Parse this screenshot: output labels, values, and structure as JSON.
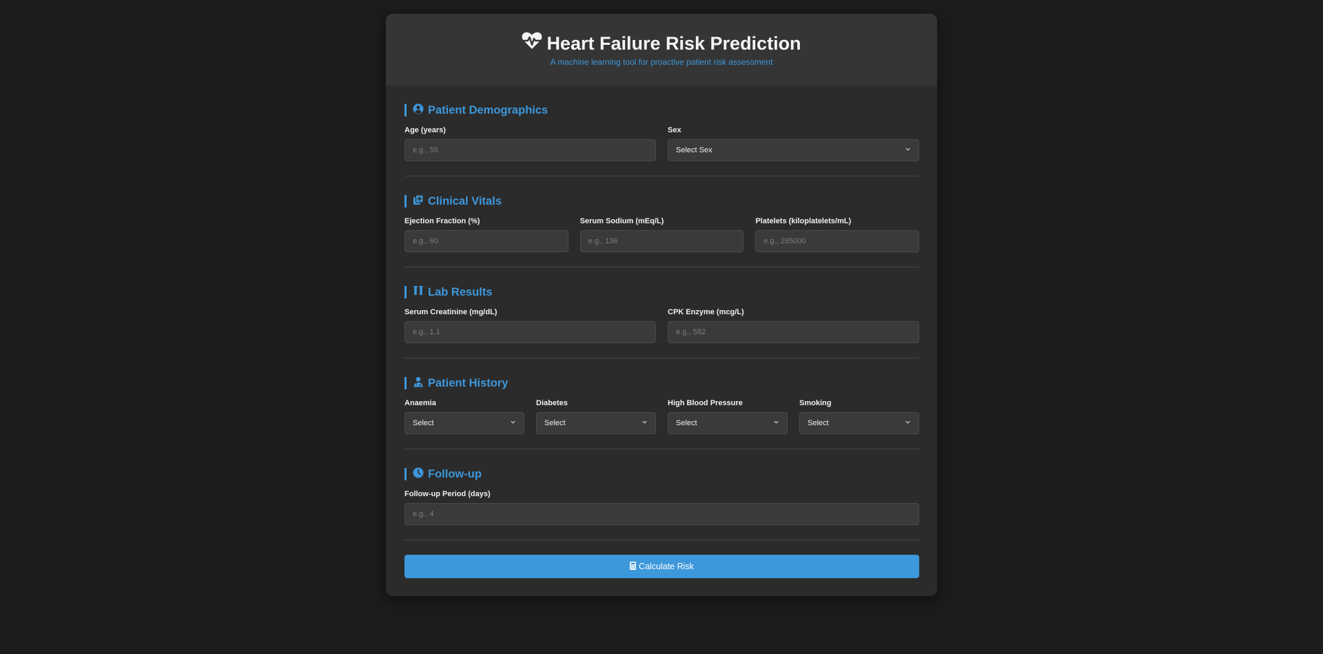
{
  "header": {
    "title": "Heart Failure Risk Prediction",
    "subtitle": "A machine learning tool for proactive patient risk assessment",
    "icon": "heart-pulse-icon"
  },
  "sections": {
    "demographics": {
      "title": "Patient Demographics",
      "icon": "user-circle-icon",
      "age_label": "Age (years)",
      "age_placeholder": "e.g., 55",
      "sex_label": "Sex",
      "sex_value": "Select Sex"
    },
    "vitals": {
      "title": "Clinical Vitals",
      "icon": "notes-medical-icon",
      "ef_label": "Ejection Fraction (%)",
      "ef_placeholder": "e.g., 60",
      "sodium_label": "Serum Sodium (mEq/L)",
      "sodium_placeholder": "e.g., 136",
      "platelets_label": "Platelets (kiloplatelets/mL)",
      "platelets_placeholder": "e.g., 265000"
    },
    "labs": {
      "title": "Lab Results",
      "icon": "vials-icon",
      "creatinine_label": "Serum Creatinine (mg/dL)",
      "creatinine_placeholder": "e.g., 1.1",
      "cpk_label": "CPK Enzyme (mcg/L)",
      "cpk_placeholder": "e.g., 582"
    },
    "history": {
      "title": "Patient History",
      "icon": "user-doctor-icon",
      "anaemia_label": "Anaemia",
      "anaemia_value": "Select",
      "diabetes_label": "Diabetes",
      "diabetes_value": "Select",
      "hbp_label": "High Blood Pressure",
      "hbp_value": "Select",
      "smoking_label": "Smoking",
      "smoking_value": "Select"
    },
    "followup": {
      "title": "Follow-up",
      "icon": "clock-icon",
      "period_label": "Follow-up Period (days)",
      "period_placeholder": "e.g., 4"
    }
  },
  "submit": {
    "label": "Calculate Risk",
    "icon": "calculator-icon"
  },
  "colors": {
    "accent": "#3d97db",
    "page_background": "#1c1c1c",
    "card_background": "#2b2b2b",
    "header_background": "#353535",
    "input_background": "#3a3a3a"
  }
}
